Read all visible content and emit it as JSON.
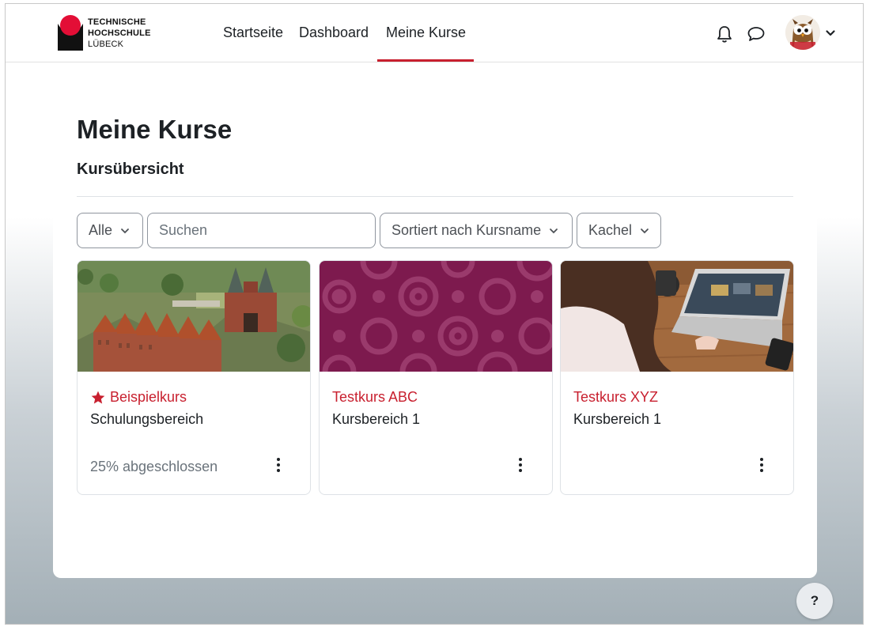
{
  "brand": {
    "line1": "TECHNISCHE",
    "line2": "HOCHSCHULE",
    "line3": "LÜBECK",
    "color": "#e30e36"
  },
  "nav": {
    "items": [
      {
        "label": "Startseite"
      },
      {
        "label": "Dashboard"
      },
      {
        "label": "Meine Kurse"
      }
    ],
    "active": "Meine Kurse",
    "accent": "#c8202f"
  },
  "header_icons": [
    "bell-icon",
    "chat-icon",
    "avatar-owl",
    "chevron-down-icon"
  ],
  "page": {
    "title": "Meine Kurse",
    "section": "Kursübersicht"
  },
  "filters": {
    "grouping": "Alle",
    "search_placeholder": "Suchen",
    "sort": "Sortiert nach Kursname",
    "view": "Kachel"
  },
  "courses": [
    {
      "name": "Beispielkurs",
      "category": "Schulungsbereich",
      "progress": "25% abgeschlossen",
      "starred": true,
      "image": "luebeck-holstentor-photo"
    },
    {
      "name": "Testkurs ABC",
      "category": "Kursbereich 1",
      "progress": "",
      "starred": false,
      "image": "magenta-circles-pattern"
    },
    {
      "name": "Testkurs XYZ",
      "category": "Kursbereich 1",
      "progress": "",
      "starred": false,
      "image": "laptop-work-photo"
    }
  ],
  "help": {
    "label": "?"
  }
}
